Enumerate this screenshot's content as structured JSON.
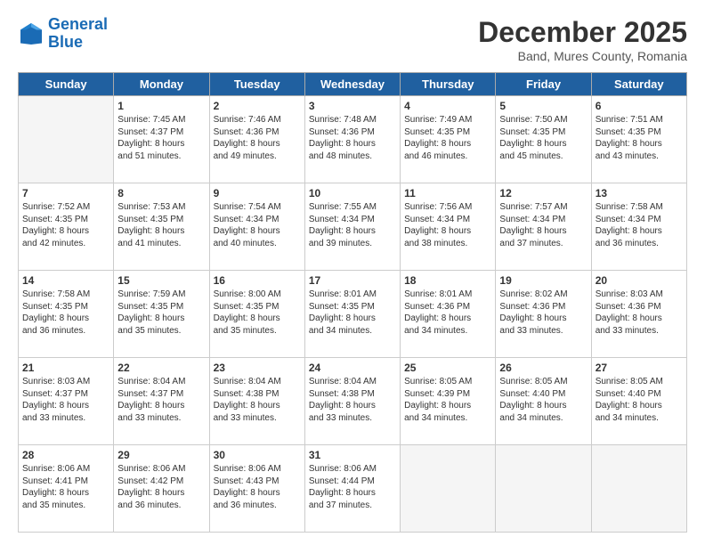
{
  "header": {
    "logo_line1": "General",
    "logo_line2": "Blue",
    "month_title": "December 2025",
    "subtitle": "Band, Mures County, Romania"
  },
  "weekdays": [
    "Sunday",
    "Monday",
    "Tuesday",
    "Wednesday",
    "Thursday",
    "Friday",
    "Saturday"
  ],
  "weeks": [
    [
      {
        "day": "",
        "info": ""
      },
      {
        "day": "1",
        "info": "Sunrise: 7:45 AM\nSunset: 4:37 PM\nDaylight: 8 hours\nand 51 minutes."
      },
      {
        "day": "2",
        "info": "Sunrise: 7:46 AM\nSunset: 4:36 PM\nDaylight: 8 hours\nand 49 minutes."
      },
      {
        "day": "3",
        "info": "Sunrise: 7:48 AM\nSunset: 4:36 PM\nDaylight: 8 hours\nand 48 minutes."
      },
      {
        "day": "4",
        "info": "Sunrise: 7:49 AM\nSunset: 4:35 PM\nDaylight: 8 hours\nand 46 minutes."
      },
      {
        "day": "5",
        "info": "Sunrise: 7:50 AM\nSunset: 4:35 PM\nDaylight: 8 hours\nand 45 minutes."
      },
      {
        "day": "6",
        "info": "Sunrise: 7:51 AM\nSunset: 4:35 PM\nDaylight: 8 hours\nand 43 minutes."
      }
    ],
    [
      {
        "day": "7",
        "info": "Sunrise: 7:52 AM\nSunset: 4:35 PM\nDaylight: 8 hours\nand 42 minutes."
      },
      {
        "day": "8",
        "info": "Sunrise: 7:53 AM\nSunset: 4:35 PM\nDaylight: 8 hours\nand 41 minutes."
      },
      {
        "day": "9",
        "info": "Sunrise: 7:54 AM\nSunset: 4:34 PM\nDaylight: 8 hours\nand 40 minutes."
      },
      {
        "day": "10",
        "info": "Sunrise: 7:55 AM\nSunset: 4:34 PM\nDaylight: 8 hours\nand 39 minutes."
      },
      {
        "day": "11",
        "info": "Sunrise: 7:56 AM\nSunset: 4:34 PM\nDaylight: 8 hours\nand 38 minutes."
      },
      {
        "day": "12",
        "info": "Sunrise: 7:57 AM\nSunset: 4:34 PM\nDaylight: 8 hours\nand 37 minutes."
      },
      {
        "day": "13",
        "info": "Sunrise: 7:58 AM\nSunset: 4:34 PM\nDaylight: 8 hours\nand 36 minutes."
      }
    ],
    [
      {
        "day": "14",
        "info": "Sunrise: 7:58 AM\nSunset: 4:35 PM\nDaylight: 8 hours\nand 36 minutes."
      },
      {
        "day": "15",
        "info": "Sunrise: 7:59 AM\nSunset: 4:35 PM\nDaylight: 8 hours\nand 35 minutes."
      },
      {
        "day": "16",
        "info": "Sunrise: 8:00 AM\nSunset: 4:35 PM\nDaylight: 8 hours\nand 35 minutes."
      },
      {
        "day": "17",
        "info": "Sunrise: 8:01 AM\nSunset: 4:35 PM\nDaylight: 8 hours\nand 34 minutes."
      },
      {
        "day": "18",
        "info": "Sunrise: 8:01 AM\nSunset: 4:36 PM\nDaylight: 8 hours\nand 34 minutes."
      },
      {
        "day": "19",
        "info": "Sunrise: 8:02 AM\nSunset: 4:36 PM\nDaylight: 8 hours\nand 33 minutes."
      },
      {
        "day": "20",
        "info": "Sunrise: 8:03 AM\nSunset: 4:36 PM\nDaylight: 8 hours\nand 33 minutes."
      }
    ],
    [
      {
        "day": "21",
        "info": "Sunrise: 8:03 AM\nSunset: 4:37 PM\nDaylight: 8 hours\nand 33 minutes."
      },
      {
        "day": "22",
        "info": "Sunrise: 8:04 AM\nSunset: 4:37 PM\nDaylight: 8 hours\nand 33 minutes."
      },
      {
        "day": "23",
        "info": "Sunrise: 8:04 AM\nSunset: 4:38 PM\nDaylight: 8 hours\nand 33 minutes."
      },
      {
        "day": "24",
        "info": "Sunrise: 8:04 AM\nSunset: 4:38 PM\nDaylight: 8 hours\nand 33 minutes."
      },
      {
        "day": "25",
        "info": "Sunrise: 8:05 AM\nSunset: 4:39 PM\nDaylight: 8 hours\nand 34 minutes."
      },
      {
        "day": "26",
        "info": "Sunrise: 8:05 AM\nSunset: 4:40 PM\nDaylight: 8 hours\nand 34 minutes."
      },
      {
        "day": "27",
        "info": "Sunrise: 8:05 AM\nSunset: 4:40 PM\nDaylight: 8 hours\nand 34 minutes."
      }
    ],
    [
      {
        "day": "28",
        "info": "Sunrise: 8:06 AM\nSunset: 4:41 PM\nDaylight: 8 hours\nand 35 minutes."
      },
      {
        "day": "29",
        "info": "Sunrise: 8:06 AM\nSunset: 4:42 PM\nDaylight: 8 hours\nand 36 minutes."
      },
      {
        "day": "30",
        "info": "Sunrise: 8:06 AM\nSunset: 4:43 PM\nDaylight: 8 hours\nand 36 minutes."
      },
      {
        "day": "31",
        "info": "Sunrise: 8:06 AM\nSunset: 4:44 PM\nDaylight: 8 hours\nand 37 minutes."
      },
      {
        "day": "",
        "info": ""
      },
      {
        "day": "",
        "info": ""
      },
      {
        "day": "",
        "info": ""
      }
    ]
  ]
}
